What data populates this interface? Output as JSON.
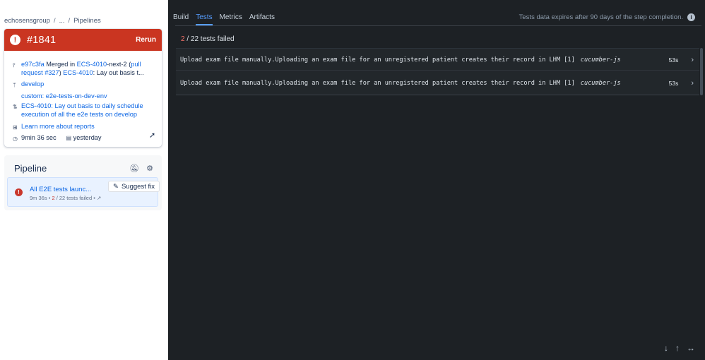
{
  "breadcrumb": {
    "workspace": "echosensgroup",
    "ellipsis": "...",
    "current": "Pipelines",
    "separator": "/"
  },
  "build": {
    "number": "#1841",
    "rerun_label": "Rerun",
    "commit": {
      "hash": "e97c3fa",
      "text1": " Merged in ",
      "branch_link": "ECS-4010",
      "text2": "-next-2 (",
      "pr_link": "pull request #327",
      "text3": ") ",
      "issue_link": "ECS-4010",
      "text4": ": Lay out basis t..."
    },
    "branch": "develop",
    "custom": "custom: e2e-tests-on-dev-env",
    "pr_title": "ECS-4010: Lay out basis to daily schedule execution of all the e2e tests on develop",
    "learn_more": "Learn more about reports",
    "duration": "9min 36 sec",
    "when": "yesterday"
  },
  "pipeline": {
    "title": "Pipeline",
    "step": {
      "name": "All E2E tests launc...",
      "duration": "9m 36s",
      "failed_count": "2",
      "total_text": " / 22 tests failed",
      "bullet": "•",
      "suggest_label": "Suggest fix"
    }
  },
  "tabs": [
    "Build",
    "Tests",
    "Metrics",
    "Artifacts"
  ],
  "active_tab": "Tests",
  "expiry_note": "Tests data expires after 90 days of the step completion.",
  "summary": {
    "failed": "2",
    "rest": " / 22 tests failed"
  },
  "tests": [
    {
      "name": "Upload exam file manually.Uploading an exam file for an unregistered patient creates their record in LHM [1]",
      "tag": "cucumber-js",
      "duration": "53s"
    },
    {
      "name": "Upload exam file manually.Uploading an exam file for an unregistered patient creates their record in LHM [1]",
      "tag": "cucumber-js",
      "duration": "53s"
    }
  ],
  "icons": {
    "build_status": "error-icon",
    "commit": "commit-icon",
    "branch": "branch-icon",
    "pr": "pull-request-icon",
    "report": "report-icon",
    "clock": "clock-icon",
    "calendar": "calendar-icon",
    "notifications_off": "bell-off-icon",
    "settings": "gear-icon",
    "suggest": "wand-icon",
    "external": "external-link-icon",
    "info": "info-icon",
    "chevron": "chevron-right-icon",
    "scroll_down": "arrow-down-icon",
    "scroll_up": "arrow-up-icon",
    "expand": "expand-horizontal-icon"
  },
  "colors": {
    "error": "#ca3521",
    "link": "#0c66e4",
    "dark_bg": "#1d2125",
    "active_tab": "#579dff",
    "failed_text": "#f87168"
  }
}
